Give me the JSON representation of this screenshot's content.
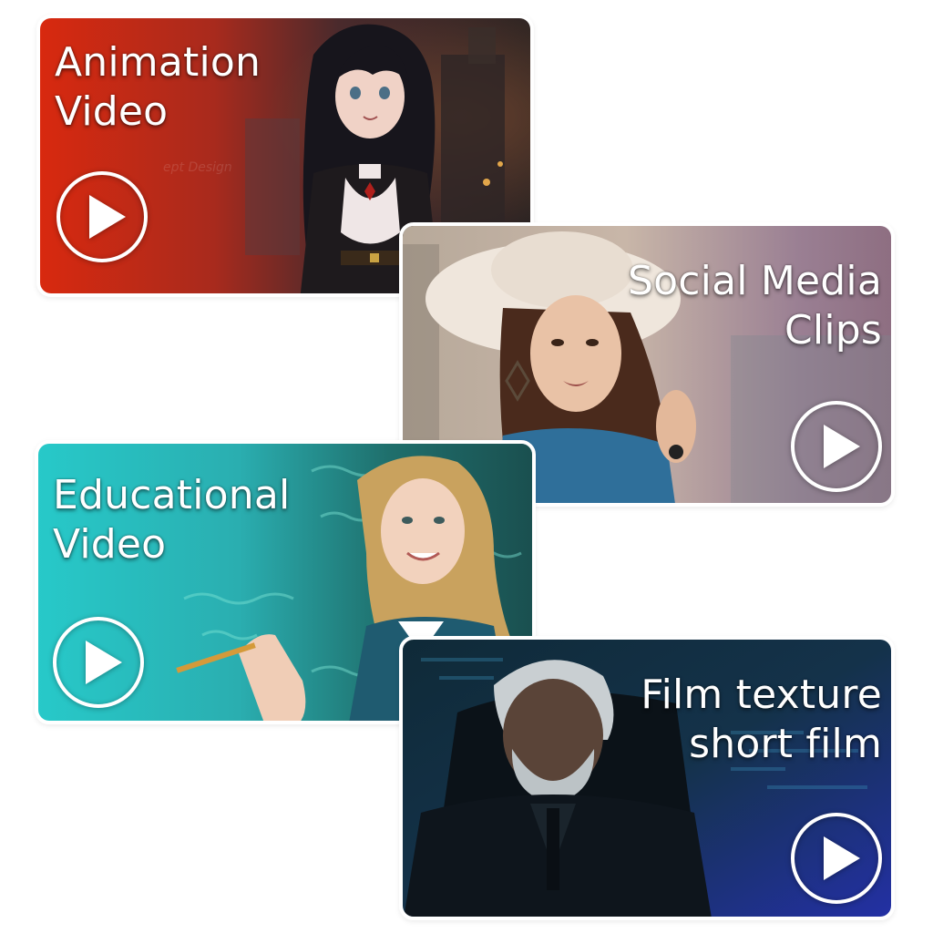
{
  "cards": [
    {
      "id": "animation",
      "title": "Animation\nVideo",
      "accent": "#d8290f",
      "play_icon": "play-circle-icon",
      "illustration": "anime-character-scene"
    },
    {
      "id": "social",
      "title": "Social Media\nClips",
      "accent": "#9a7f93",
      "play_icon": "play-circle-icon",
      "illustration": "woman-in-hat-portrait"
    },
    {
      "id": "education",
      "title": "Educational\nVideo",
      "accent": "#27c9c9",
      "play_icon": "play-circle-icon",
      "illustration": "teacher-at-chalkboard"
    },
    {
      "id": "film",
      "title": "Film texture\nshort film",
      "accent": "#2430a8",
      "play_icon": "play-circle-icon",
      "illustration": "elderly-man-in-suit"
    }
  ]
}
